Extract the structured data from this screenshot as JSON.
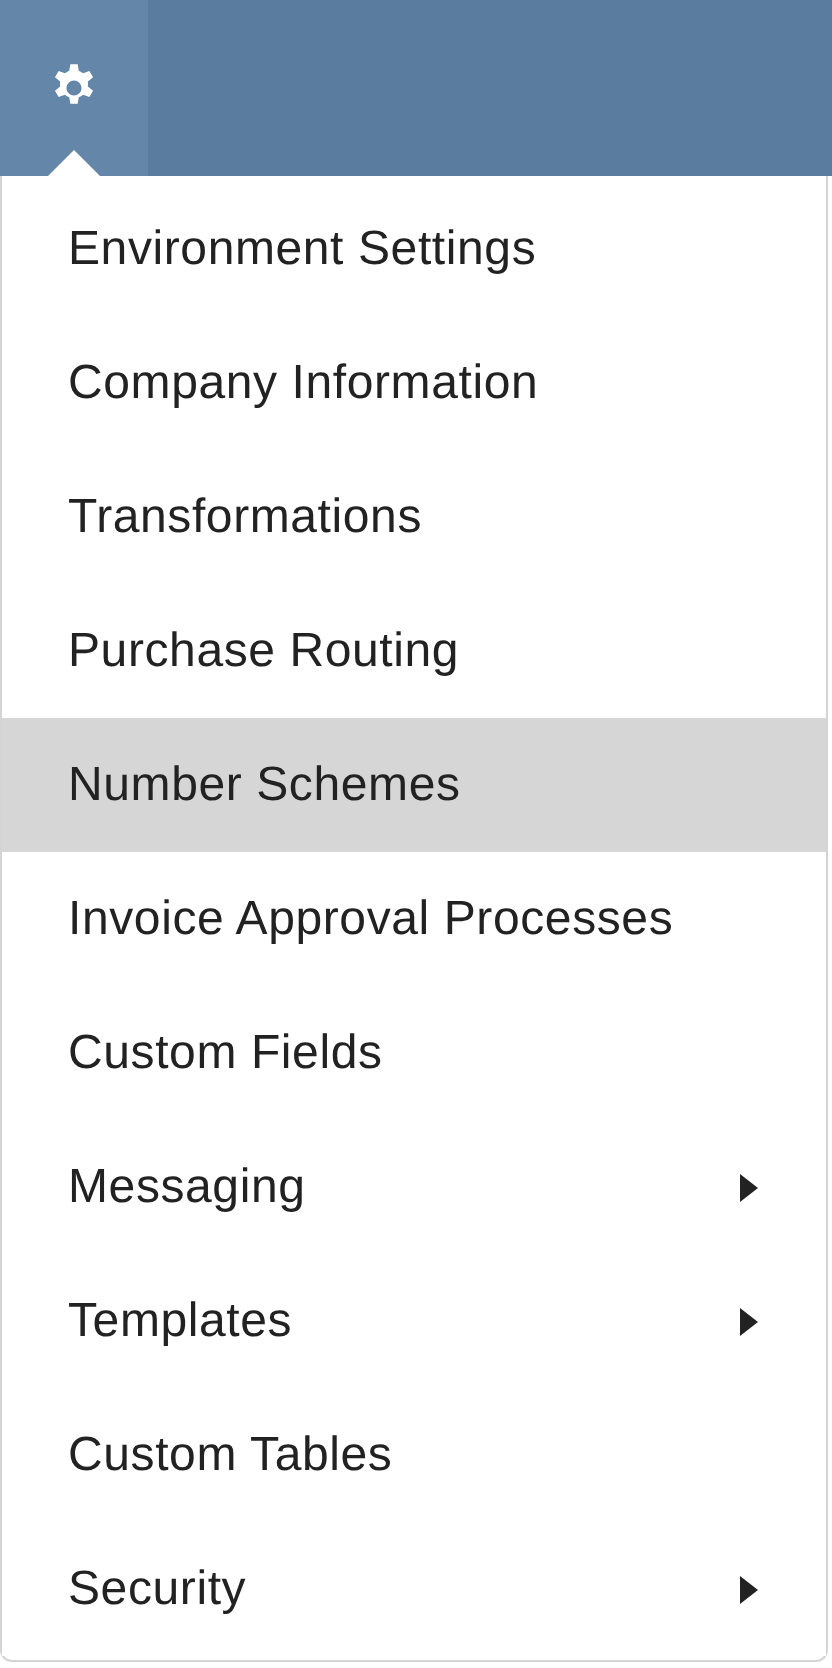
{
  "menu": {
    "items": [
      {
        "label": "Environment Settings",
        "selected": false,
        "submenu": false
      },
      {
        "label": "Company Information",
        "selected": false,
        "submenu": false
      },
      {
        "label": "Transformations",
        "selected": false,
        "submenu": false
      },
      {
        "label": "Purchase Routing",
        "selected": false,
        "submenu": false
      },
      {
        "label": "Number Schemes",
        "selected": true,
        "submenu": false
      },
      {
        "label": "Invoice Approval Processes",
        "selected": false,
        "submenu": false
      },
      {
        "label": "Custom Fields",
        "selected": false,
        "submenu": false
      },
      {
        "label": "Messaging",
        "selected": false,
        "submenu": true
      },
      {
        "label": "Templates",
        "selected": false,
        "submenu": true
      },
      {
        "label": "Custom Tables",
        "selected": false,
        "submenu": false
      },
      {
        "label": "Security",
        "selected": false,
        "submenu": true
      }
    ]
  }
}
